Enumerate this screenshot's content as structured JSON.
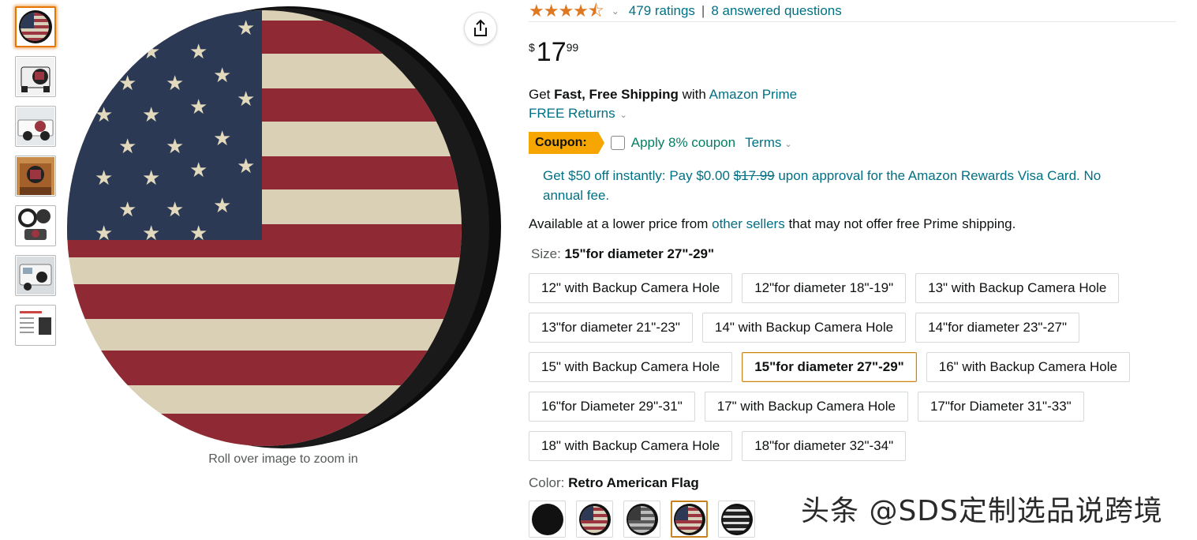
{
  "gallery": {
    "thumbnails": [
      {
        "name": "thumb-flag-cover",
        "selected": true
      },
      {
        "name": "thumb-jeep-rear"
      },
      {
        "name": "thumb-jeep-white"
      },
      {
        "name": "thumb-jeep-orange"
      },
      {
        "name": "thumb-cover-variants"
      },
      {
        "name": "thumb-rv"
      },
      {
        "name": "thumb-size-chart"
      }
    ],
    "zoom_hint": "Roll over image to zoom in"
  },
  "rating": {
    "stars": "★★★★⯪",
    "stars_value": 4.5,
    "ratings_text": "479 ratings",
    "separator": "|",
    "questions_text": "8 answered questions"
  },
  "price": {
    "symbol": "$",
    "whole": "17",
    "fraction": "99"
  },
  "shipping": {
    "prefix": "Get ",
    "bold": "Fast, Free Shipping",
    "middle": " with ",
    "link": "Amazon Prime"
  },
  "returns": {
    "label": "FREE Returns"
  },
  "coupon": {
    "badge": "Coupon:",
    "text": "Apply 8% coupon",
    "terms": "Terms"
  },
  "promo": {
    "part1": "Get $50 off instantly: Pay $0.00 ",
    "strike": "$17.99",
    "part2": " upon approval for the Amazon Rewards Visa Card. No annual fee."
  },
  "availability": {
    "prefix": "Available at a lower price from ",
    "link": "other sellers",
    "suffix": " that may not offer free Prime shipping."
  },
  "size": {
    "label": "Size: ",
    "selected": "15\"for diameter 27\"-29\"",
    "options": [
      "12\" with Backup Camera Hole",
      "12\"for diameter 18\"-19\"",
      "13\" with Backup Camera Hole",
      "13\"for diameter 21\"-23\"",
      "14\" with Backup Camera Hole",
      "14\"for diameter 23\"-27\"",
      "15\" with Backup Camera Hole",
      "15\"for diameter 27\"-29\"",
      "16\" with Backup Camera Hole",
      "16\"for Diameter 29\"-31\"",
      "17\" with Backup Camera Hole",
      "17\"for Diameter 31\"-33\"",
      "18\" with Backup Camera Hole",
      "18\"for diameter 32\"-34\""
    ]
  },
  "color": {
    "label": "Color: ",
    "selected": "Retro American Flag",
    "swatches": [
      "black",
      "retro-flag",
      "gray-flag",
      "retro-flag-selected",
      "black-white-flag"
    ]
  },
  "watermark": "头条 @SDS定制选品说跨境",
  "colors": {
    "link": "#007185",
    "star": "#de7921",
    "coupon_badge": "#f7a500",
    "selected_border": "#c7821e",
    "coupon_text": "#067d62"
  }
}
